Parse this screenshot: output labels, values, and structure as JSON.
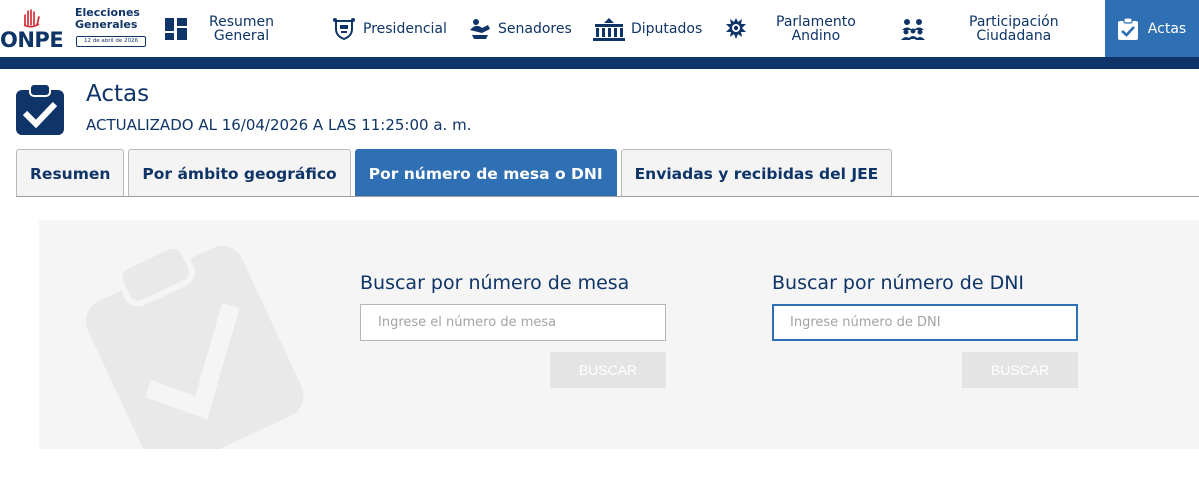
{
  "brand": {
    "word": "ONPE",
    "event_line1": "Elecciones",
    "event_line2": "Generales",
    "date_badge": "12 de abril de 2026"
  },
  "nav": {
    "items": [
      {
        "label": "Resumen General",
        "icon": "dashboard-icon"
      },
      {
        "label": "Presidencial",
        "icon": "coat-of-arms-icon"
      },
      {
        "label": "Senadores",
        "icon": "senate-icon"
      },
      {
        "label": "Diputados",
        "icon": "congress-building-icon"
      },
      {
        "label": "Parlamento Andino",
        "icon": "andean-parliament-icon"
      },
      {
        "label": "Participación Ciudadana",
        "icon": "people-icon"
      },
      {
        "label": "Actas",
        "icon": "clipboard-check-icon",
        "active": true
      }
    ],
    "label_resumen_1": "Resumen",
    "label_resumen_2": "General",
    "label_presidencial": "Presidencial",
    "label_senadores": "Senadores",
    "label_diputados": "Diputados",
    "label_parlamento_1": "Parlamento",
    "label_parlamento_2": "Andino",
    "label_participacion_1": "Participación",
    "label_participacion_2": "Ciudadana",
    "label_actas": "Actas"
  },
  "page": {
    "title": "Actas",
    "updated": "ACTUALIZADO AL 16/04/2026 A LAS 11:25:00 a. m."
  },
  "tabs": [
    {
      "label": "Resumen"
    },
    {
      "label": "Por ámbito geográfico"
    },
    {
      "label": "Por número de mesa o DNI",
      "active": true
    },
    {
      "label": "Enviadas y recibidas del JEE"
    }
  ],
  "search_mesa": {
    "title": "Buscar por número de mesa",
    "placeholder": "Ingrese el número de mesa",
    "value": "",
    "button": "BUSCAR"
  },
  "search_dni": {
    "title": "Buscar por número de DNI",
    "placeholder": "Ingrese número de DNI",
    "value": "",
    "button": "BUSCAR"
  },
  "colors": {
    "primary": "#0f3467",
    "accent": "#2f6fb4",
    "panel": "#f5f5f5",
    "disabled_button": "#e4e4e4"
  }
}
